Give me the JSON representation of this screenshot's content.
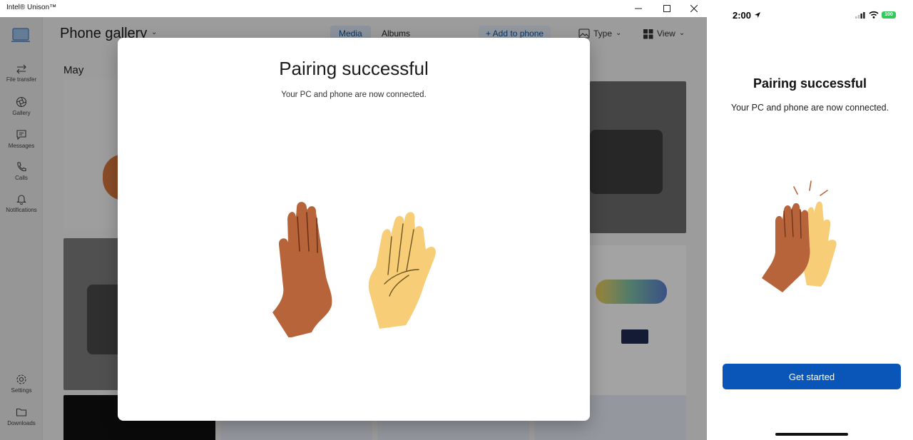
{
  "window": {
    "title": "Intel® Unison™"
  },
  "rail": {
    "items": [
      {
        "label": "File transfer",
        "icon": "swap-arrows-icon"
      },
      {
        "label": "Gallery",
        "icon": "aperture-icon"
      },
      {
        "label": "Messages",
        "icon": "chat-icon"
      },
      {
        "label": "Calls",
        "icon": "phone-icon"
      },
      {
        "label": "Notifications",
        "icon": "bell-icon"
      }
    ],
    "bottom": [
      {
        "label": "Settings",
        "icon": "gear-icon"
      },
      {
        "label": "Downloads",
        "icon": "folder-icon"
      }
    ]
  },
  "gallery": {
    "title": "Phone gallery",
    "tabs": [
      {
        "label": "Media",
        "active": true
      },
      {
        "label": "Albums",
        "active": false
      }
    ],
    "add_to_phone": "+ Add to phone",
    "type_label": "Type",
    "view_label": "View",
    "month": "May"
  },
  "dialog": {
    "title": "Pairing successful",
    "subtitle": "Your PC and phone are now connected."
  },
  "phone": {
    "time": "2:00",
    "battery": "100",
    "title": "Pairing successful",
    "subtitle": "Your PC and phone are now connected.",
    "button": "Get started"
  },
  "colors": {
    "accent": "#0a56b8",
    "hand_dark": "#b8643a",
    "hand_light": "#f8cd77",
    "battery_green": "#34c759"
  }
}
